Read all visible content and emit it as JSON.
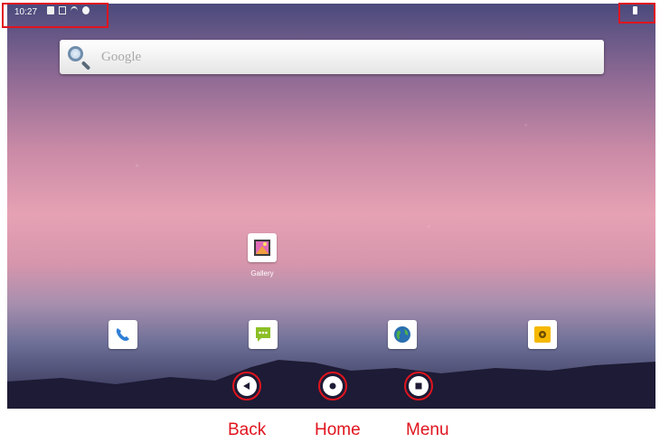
{
  "status_bar": {
    "time": "10:27"
  },
  "search": {
    "placeholder": "Google"
  },
  "home": {
    "apps": [
      {
        "label": "Gallery"
      }
    ]
  },
  "nav_labels": {
    "back": "Back",
    "home": "Home",
    "menu": "Menu"
  },
  "colors": {
    "annotation": "#e0141e",
    "phone_icon": "#2f7fd6",
    "messaging_icon": "#8cbf26",
    "browser_icon": "#2a6fb0",
    "settings_icon": "#f5b800"
  }
}
